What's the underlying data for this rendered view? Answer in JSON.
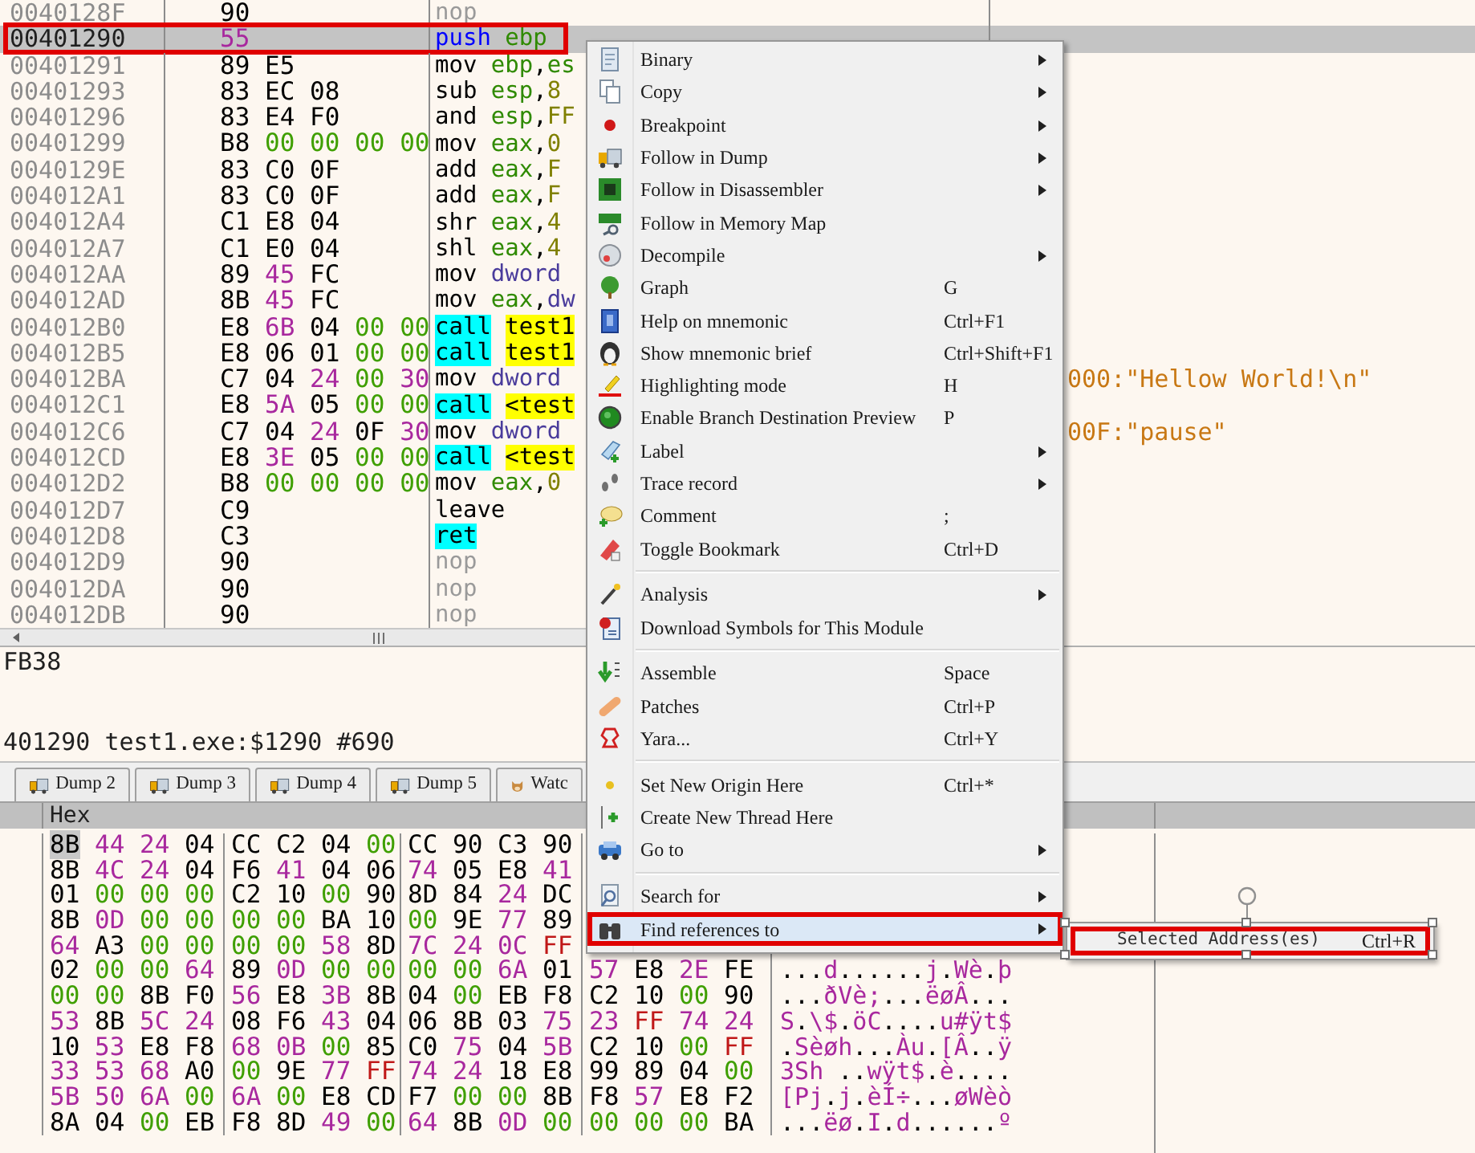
{
  "disassembly": {
    "rows": [
      {
        "address": "0040128F",
        "bytes": "90",
        "mnemonic": "nop",
        "kind": "nop",
        "operand": [],
        "selected": false,
        "outlined": false
      },
      {
        "address": "00401290",
        "bytes": "55",
        "mnemonic": "push",
        "kind": "push",
        "operand": [
          {
            "text": "ebp",
            "kind": "reg"
          }
        ],
        "selected": true,
        "outlined": true
      },
      {
        "address": "00401291",
        "bytes": "89 E5",
        "mnemonic": "mov",
        "kind": "plain",
        "operand": [
          {
            "text": "ebp",
            "kind": "reg"
          },
          {
            "text": ",",
            "kind": "sep"
          },
          {
            "text": "es",
            "kind": "reg"
          }
        ],
        "selected": false,
        "outlined": false
      },
      {
        "address": "00401293",
        "bytes": "83 EC 08",
        "mnemonic": "sub",
        "kind": "plain",
        "operand": [
          {
            "text": "esp",
            "kind": "reg"
          },
          {
            "text": ",",
            "kind": "sep"
          },
          {
            "text": "8",
            "kind": "imm"
          }
        ],
        "selected": false,
        "outlined": false
      },
      {
        "address": "00401296",
        "bytes": "83 E4 F0",
        "mnemonic": "and",
        "kind": "plain",
        "operand": [
          {
            "text": "esp",
            "kind": "reg"
          },
          {
            "text": ",",
            "kind": "sep"
          },
          {
            "text": "FF",
            "kind": "imm"
          }
        ],
        "selected": false,
        "outlined": false
      },
      {
        "address": "00401299",
        "bytes": "B8 00 00 00 00",
        "mnemonic": "mov",
        "kind": "plain",
        "operand": [
          {
            "text": "eax",
            "kind": "reg"
          },
          {
            "text": ",",
            "kind": "sep"
          },
          {
            "text": "0",
            "kind": "imm"
          }
        ],
        "selected": false,
        "outlined": false
      },
      {
        "address": "0040129E",
        "bytes": "83 C0 0F",
        "mnemonic": "add",
        "kind": "plain",
        "operand": [
          {
            "text": "eax",
            "kind": "reg"
          },
          {
            "text": ",",
            "kind": "sep"
          },
          {
            "text": "F",
            "kind": "imm"
          }
        ],
        "selected": false,
        "outlined": false
      },
      {
        "address": "004012A1",
        "bytes": "83 C0 0F",
        "mnemonic": "add",
        "kind": "plain",
        "operand": [
          {
            "text": "eax",
            "kind": "reg"
          },
          {
            "text": ",",
            "kind": "sep"
          },
          {
            "text": "F",
            "kind": "imm"
          }
        ],
        "selected": false,
        "outlined": false
      },
      {
        "address": "004012A4",
        "bytes": "C1 E8 04",
        "mnemonic": "shr",
        "kind": "plain",
        "operand": [
          {
            "text": "eax",
            "kind": "reg"
          },
          {
            "text": ",",
            "kind": "sep"
          },
          {
            "text": "4",
            "kind": "imm"
          }
        ],
        "selected": false,
        "outlined": false
      },
      {
        "address": "004012A7",
        "bytes": "C1 E0 04",
        "mnemonic": "shl",
        "kind": "plain",
        "operand": [
          {
            "text": "eax",
            "kind": "reg"
          },
          {
            "text": ",",
            "kind": "sep"
          },
          {
            "text": "4",
            "kind": "imm"
          }
        ],
        "selected": false,
        "outlined": false
      },
      {
        "address": "004012AA",
        "bytes": "89 45 FC",
        "mnemonic": "mov",
        "kind": "plain",
        "operand": [
          {
            "text": "dword",
            "kind": "mem"
          }
        ],
        "selected": false,
        "outlined": false
      },
      {
        "address": "004012AD",
        "bytes": "8B 45 FC",
        "mnemonic": "mov",
        "kind": "plain",
        "operand": [
          {
            "text": "eax",
            "kind": "reg"
          },
          {
            "text": ",",
            "kind": "sep"
          },
          {
            "text": "dw",
            "kind": "mem"
          }
        ],
        "selected": false,
        "outlined": false
      },
      {
        "address": "004012B0",
        "bytes": "E8 6B 04 00 00",
        "mnemonic": "call",
        "kind": "branch",
        "operand": [
          {
            "text": "test1",
            "kind": "sym"
          }
        ],
        "selected": false,
        "outlined": false
      },
      {
        "address": "004012B5",
        "bytes": "E8 06 01 00 00",
        "mnemonic": "call",
        "kind": "branch",
        "operand": [
          {
            "text": "test1",
            "kind": "sym"
          }
        ],
        "selected": false,
        "outlined": false
      },
      {
        "address": "004012BA",
        "bytes": "C7 04 24 00 30",
        "mnemonic": "mov",
        "kind": "plain",
        "operand": [
          {
            "text": "dword",
            "kind": "mem"
          }
        ],
        "comment": "000:\"Hellow World!\\n\"",
        "selected": false,
        "outlined": false
      },
      {
        "address": "004012C1",
        "bytes": "E8 5A 05 00 00",
        "mnemonic": "call",
        "kind": "branch",
        "operand": [
          {
            "text": "<test",
            "kind": "sym"
          }
        ],
        "selected": false,
        "outlined": false
      },
      {
        "address": "004012C6",
        "bytes": "C7 04 24 0F 30",
        "mnemonic": "mov",
        "kind": "plain",
        "operand": [
          {
            "text": "dword",
            "kind": "mem"
          }
        ],
        "comment": "00F:\"pause\"",
        "selected": false,
        "outlined": false
      },
      {
        "address": "004012CD",
        "bytes": "E8 3E 05 00 00",
        "mnemonic": "call",
        "kind": "branch",
        "operand": [
          {
            "text": "<test",
            "kind": "sym"
          }
        ],
        "selected": false,
        "outlined": false
      },
      {
        "address": "004012D2",
        "bytes": "B8 00 00 00 00",
        "mnemonic": "mov",
        "kind": "plain",
        "operand": [
          {
            "text": "eax",
            "kind": "reg"
          },
          {
            "text": ",",
            "kind": "sep"
          },
          {
            "text": "0",
            "kind": "imm"
          }
        ],
        "selected": false,
        "outlined": false
      },
      {
        "address": "004012D7",
        "bytes": "C9",
        "mnemonic": "leave",
        "kind": "plain",
        "operand": [],
        "selected": false,
        "outlined": false
      },
      {
        "address": "004012D8",
        "bytes": "C3",
        "mnemonic": "ret",
        "kind": "branch",
        "operand": [],
        "selected": false,
        "outlined": false
      },
      {
        "address": "004012D9",
        "bytes": "90",
        "mnemonic": "nop",
        "kind": "nop",
        "operand": [],
        "selected": false,
        "outlined": false
      },
      {
        "address": "004012DA",
        "bytes": "90",
        "mnemonic": "nop",
        "kind": "nop",
        "operand": [],
        "selected": false,
        "outlined": false
      },
      {
        "address": "004012DB",
        "bytes": "90",
        "mnemonic": "nop",
        "kind": "nop",
        "operand": [],
        "selected": false,
        "outlined": false
      }
    ]
  },
  "info": {
    "lines": [
      "FB38",
      "401290 test1.exe:$1290 #690"
    ]
  },
  "dump_tabs": [
    {
      "label": "Dump 2",
      "kind": "dump",
      "selected": false
    },
    {
      "label": "Dump 3",
      "kind": "dump",
      "selected": false
    },
    {
      "label": "Dump 4",
      "kind": "dump",
      "selected": false
    },
    {
      "label": "Dump 5",
      "kind": "dump",
      "selected": false
    },
    {
      "label": "Watc",
      "kind": "watch",
      "selected": false
    }
  ],
  "dump": {
    "column_header": "Hex",
    "rows": [
      {
        "groups": [
          "8B 44 24 04",
          "CC C2 04 00",
          "CC 90 C3 90"
        ],
        "selected": true
      },
      {
        "groups": [
          "8B 4C 24 04",
          "F6 41 04 06",
          "74 05 E8 41"
        ],
        "selected": false
      },
      {
        "groups": [
          "01 00 00 00",
          "C2 10 00 90",
          "8D 84 24 DC"
        ],
        "selected": false
      },
      {
        "groups": [
          "8B 0D 00 00",
          "00 00 BA 10",
          "00 9E 77 89"
        ],
        "selected": false
      },
      {
        "groups": [
          "64 A3 00 00",
          "00 00 58 8D",
          "7C 24 0C FF"
        ],
        "selected": false
      },
      {
        "groups": [
          "02 00 00 64",
          "89 0D 00 00",
          "00 00 6A 01",
          "57 E8 2E FE"
        ],
        "ascii": "...d......j.Wè.þ",
        "selected": false
      },
      {
        "groups": [
          "00 00 8B F0",
          "56 E8 3B 8B",
          "04 00 EB F8",
          "C2 10 00 90"
        ],
        "ascii": "...ðVè;...ëøÂ...",
        "selected": false
      },
      {
        "groups": [
          "53 8B 5C 24",
          "08 F6 43 04",
          "06 8B 03 75",
          "23 FF 74 24"
        ],
        "ascii": "S.\\$.öC....u#ÿt$",
        "selected": false
      },
      {
        "groups": [
          "10 53 E8 F8",
          "68 0B 00 85",
          "C0 75 04 5B",
          "C2 10 00 FF"
        ],
        "ascii": ".Sèøh...Àu.[Â..ÿ",
        "selected": false
      },
      {
        "groups": [
          "33 53 68 A0",
          "00 9E 77 FF",
          "74 24 18 E8",
          "99 89 04 00"
        ],
        "ascii": "3Sh ..wÿt$.è....",
        "selected": false
      },
      {
        "groups": [
          "5B 50 6A 00",
          "6A 00 E8 CD",
          "F7 00 00 8B",
          "F8 57 E8 F2"
        ],
        "ascii": "[Pj.j.èÍ÷...øWèò",
        "selected": false
      },
      {
        "groups": [
          "8A 04 00 EB",
          "F8 8D 49 00",
          "64 8B 0D 00",
          "00 00 00 BA"
        ],
        "ascii": "...ëø.I.d......º",
        "selected": false
      }
    ]
  },
  "context_menu": {
    "items": [
      {
        "kind": "item",
        "label": "Binary",
        "submenu": true,
        "selected": false,
        "outlined": false
      },
      {
        "kind": "item",
        "label": "Copy",
        "submenu": true,
        "selected": false,
        "outlined": false
      },
      {
        "kind": "item",
        "label": "Breakpoint",
        "submenu": true,
        "selected": false,
        "outlined": false
      },
      {
        "kind": "item",
        "label": "Follow in Dump",
        "submenu": true,
        "selected": false,
        "outlined": false
      },
      {
        "kind": "item",
        "label": "Follow in Disassembler",
        "submenu": true,
        "selected": false,
        "outlined": false
      },
      {
        "kind": "item",
        "label": "Follow in Memory Map",
        "submenu": false,
        "selected": false,
        "outlined": false
      },
      {
        "kind": "item",
        "label": "Decompile",
        "submenu": true,
        "selected": false,
        "outlined": false
      },
      {
        "kind": "item",
        "label": "Graph",
        "shortcut": "G",
        "submenu": false,
        "selected": false,
        "outlined": false
      },
      {
        "kind": "item",
        "label": "Help on mnemonic",
        "shortcut": "Ctrl+F1",
        "submenu": false,
        "selected": false,
        "outlined": false
      },
      {
        "kind": "item",
        "label": "Show mnemonic brief",
        "shortcut": "Ctrl+Shift+F1",
        "submenu": false,
        "selected": false,
        "outlined": false
      },
      {
        "kind": "item",
        "label": "Highlighting mode",
        "shortcut": "H",
        "submenu": false,
        "selected": false,
        "outlined": false
      },
      {
        "kind": "item",
        "label": "Enable Branch Destination Preview",
        "shortcut": "P",
        "submenu": false,
        "selected": false,
        "outlined": false
      },
      {
        "kind": "item",
        "label": "Label",
        "submenu": true,
        "selected": false,
        "outlined": false
      },
      {
        "kind": "item",
        "label": "Trace record",
        "submenu": true,
        "selected": false,
        "outlined": false
      },
      {
        "kind": "item",
        "label": "Comment",
        "shortcut": ";",
        "submenu": false,
        "selected": false,
        "outlined": false
      },
      {
        "kind": "item",
        "label": "Toggle Bookmark",
        "shortcut": "Ctrl+D",
        "submenu": false,
        "selected": false,
        "outlined": false
      },
      {
        "kind": "separator"
      },
      {
        "kind": "item",
        "label": "Analysis",
        "submenu": true,
        "selected": false,
        "outlined": false
      },
      {
        "kind": "item",
        "label": "Download Symbols for This Module",
        "submenu": false,
        "selected": false,
        "outlined": false
      },
      {
        "kind": "separator"
      },
      {
        "kind": "item",
        "label": "Assemble",
        "shortcut": "Space",
        "submenu": false,
        "selected": false,
        "outlined": false
      },
      {
        "kind": "item",
        "label": "Patches",
        "shortcut": "Ctrl+P",
        "submenu": false,
        "selected": false,
        "outlined": false
      },
      {
        "kind": "item",
        "label": "Yara...",
        "shortcut": "Ctrl+Y",
        "submenu": false,
        "selected": false,
        "outlined": false
      },
      {
        "kind": "separator"
      },
      {
        "kind": "item",
        "label": "Set New Origin Here",
        "shortcut": "Ctrl+*",
        "submenu": false,
        "selected": false,
        "outlined": false
      },
      {
        "kind": "item",
        "label": "Create New Thread Here",
        "submenu": false,
        "selected": false,
        "outlined": false
      },
      {
        "kind": "item",
        "label": "Go to",
        "submenu": true,
        "selected": false,
        "outlined": false
      },
      {
        "kind": "separator"
      },
      {
        "kind": "item",
        "label": "Search for",
        "submenu": true,
        "selected": false,
        "outlined": false
      },
      {
        "kind": "item",
        "label": "Find references to",
        "submenu": true,
        "selected": true,
        "outlined": true
      }
    ]
  },
  "submenu": {
    "items": [
      {
        "label": "Selected Address(es)",
        "shortcut": "Ctrl+R",
        "selected": false,
        "outlined": true
      }
    ]
  }
}
